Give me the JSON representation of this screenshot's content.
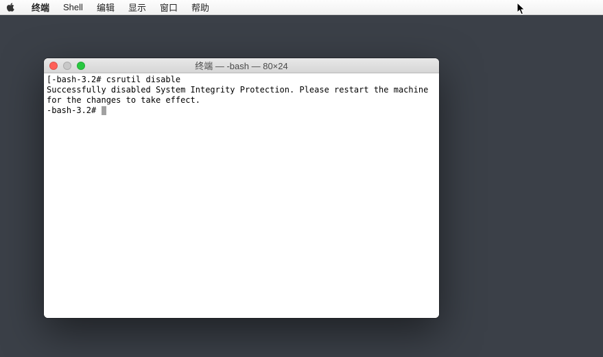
{
  "menubar": {
    "app_name": "终端",
    "items": [
      "Shell",
      "编辑",
      "显示",
      "窗口",
      "帮助"
    ]
  },
  "window": {
    "title": "终端 — -bash — 80×24"
  },
  "terminal": {
    "line1_prompt": "[-bash-3.2#",
    "line1_cmd": " csrutil disable",
    "line2": "Successfully disabled System Integrity Protection. Please restart the machine for the changes to take effect.",
    "line3_prompt": "-bash-3.2# "
  }
}
